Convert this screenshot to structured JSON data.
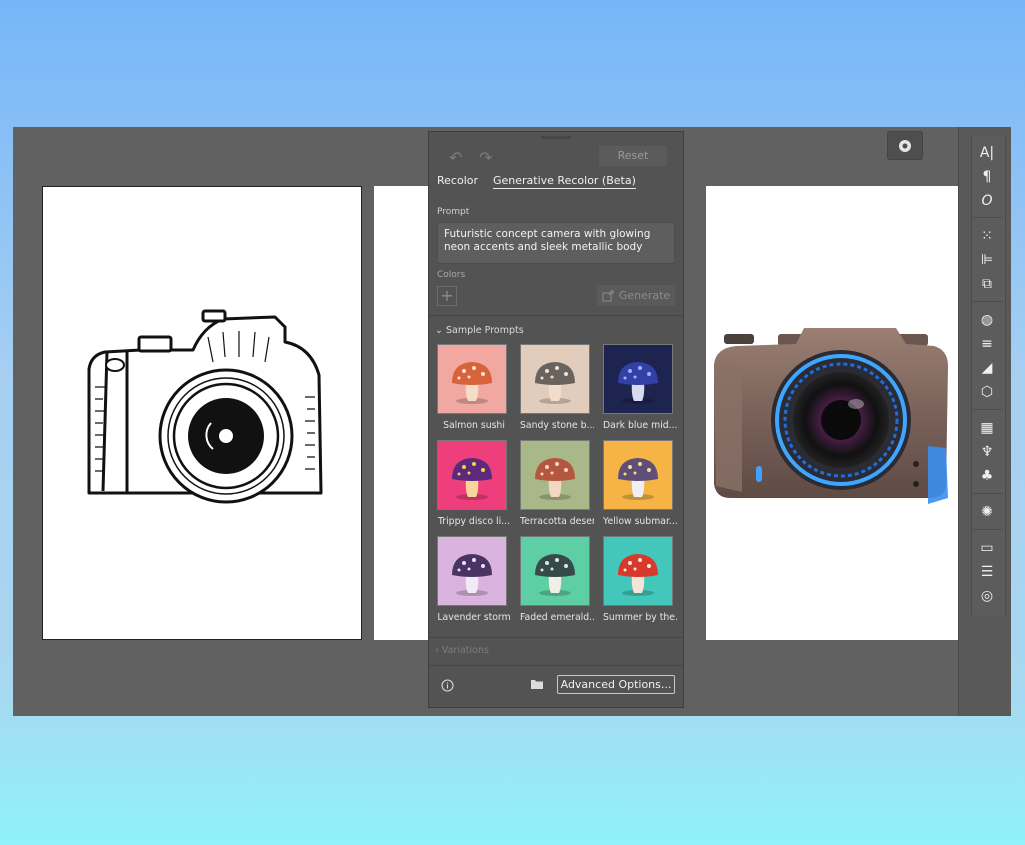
{
  "panel": {
    "reset_label": "Reset",
    "tabs": [
      {
        "label": "Recolor",
        "active": false
      },
      {
        "label": "Generative Recolor (Beta)",
        "active": true
      }
    ],
    "prompt_label": "Prompt",
    "prompt_value": "Futuristic concept camera with glowing neon accents and sleek metallic body",
    "colors_label": "Colors",
    "generate_label": "Generate",
    "sample_prompts_label": "Sample Prompts",
    "samples": [
      {
        "label": "Salmon sushi",
        "bg": "#f0a8a0",
        "cap": "#d8623a",
        "dots": "#f6e6d8",
        "stem": "#f3ddc8"
      },
      {
        "label": "Sandy stone b...",
        "bg": "#e2cdbc",
        "cap": "#6a625c",
        "dots": "#ece2d6",
        "stem": "#f2dccb"
      },
      {
        "label": "Dark blue mid...",
        "bg": "#1d2450",
        "cap": "#3340a6",
        "dots": "#9fb0ff",
        "stem": "#d9dcef"
      },
      {
        "label": "Trippy disco li...",
        "bg": "#ee3f7c",
        "cap": "#5b2a7c",
        "dots": "#f6d542",
        "stem": "#f6d69a"
      },
      {
        "label": "Terracotta desert",
        "bg": "#a8b889",
        "cap": "#b5573e",
        "dots": "#f1d8c8",
        "stem": "#f2d7c2"
      },
      {
        "label": "Yellow submar...",
        "bg": "#f6b446",
        "cap": "#5f4e77",
        "dots": "#f6dd8e",
        "stem": "#eef0f6"
      },
      {
        "label": "Lavender storm",
        "bg": "#dab4de",
        "cap": "#4a3463",
        "dots": "#efe1f2",
        "stem": "#f3eaf7"
      },
      {
        "label": "Faded emerald...",
        "bg": "#5ecea5",
        "cap": "#37494a",
        "dots": "#cfeee2",
        "stem": "#f1ede7"
      },
      {
        "label": "Summer by the...",
        "bg": "#43c7ba",
        "cap": "#d8392d",
        "dots": "#ffe8e0",
        "stem": "#f6e4d8"
      }
    ],
    "variations_label": "Variations",
    "advanced_options_label": "Advanced Options..."
  },
  "toolbar": {
    "icons": [
      "type-icon",
      "paragraph-icon",
      "glyph-icon",
      "transform-icon",
      "align-icon",
      "pathfinder-icon",
      "color-icon",
      "properties-icon",
      "gradient-icon",
      "3d-icon",
      "swatches-icon",
      "brushes-icon",
      "symbols-icon",
      "appearance-icon",
      "gradient-panel-icon",
      "stroke-icon",
      "transparency-icon"
    ]
  }
}
